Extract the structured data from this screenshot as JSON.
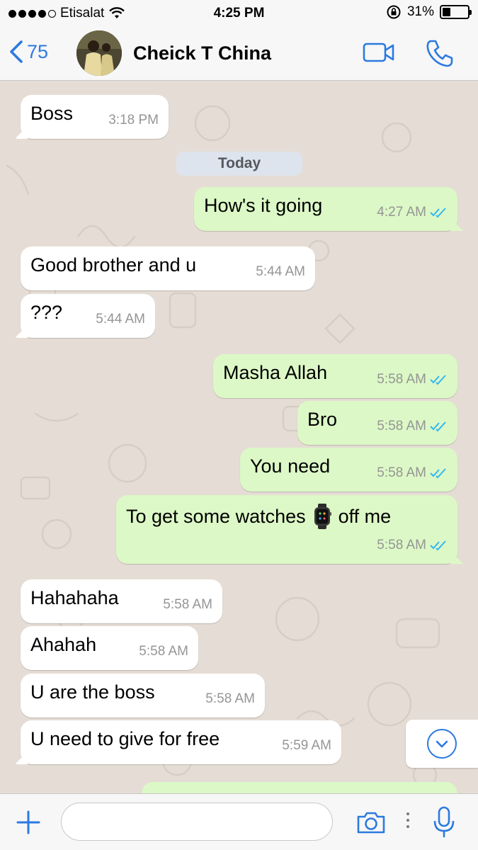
{
  "status_bar": {
    "carrier": "Etisalat",
    "time": "4:25 PM",
    "battery": "31%",
    "battery_level": 0.31
  },
  "header": {
    "back_count": "75",
    "contact_name": "Cheick T China"
  },
  "date_separator": "Today",
  "messages": [
    {
      "text": "Boss",
      "time": "3:18 PM",
      "direction": "in"
    },
    {
      "text": "How's it going",
      "time": "4:27 AM",
      "direction": "out"
    },
    {
      "text": "Good brother and u",
      "time": "5:44 AM",
      "direction": "in"
    },
    {
      "text": "???",
      "time": "5:44 AM",
      "direction": "in"
    },
    {
      "text": "Masha Allah",
      "time": "5:58 AM",
      "direction": "out"
    },
    {
      "text": "Bro",
      "time": "5:58 AM",
      "direction": "out"
    },
    {
      "text": "You need",
      "time": "5:58 AM",
      "direction": "out"
    },
    {
      "text": "To get some watches",
      "text_after": "off me",
      "time": "5:58 AM",
      "direction": "out",
      "emoji": "watch-icon"
    },
    {
      "text": "Hahahaha",
      "time": "5:58 AM",
      "direction": "in"
    },
    {
      "text": "Ahahah",
      "time": "5:58 AM",
      "direction": "in"
    },
    {
      "text": "U are the boss",
      "time": "5:58 AM",
      "direction": "in"
    },
    {
      "text": "U need to give for free",
      "time": "5:59 AM",
      "direction": "in"
    }
  ],
  "input": {
    "placeholder": "",
    "value": ""
  },
  "colors": {
    "accent": "#2c7ae0",
    "outgoing_bubble": "#dcf8c6",
    "incoming_bubble": "#ffffff",
    "chat_background": "#e5ddd5",
    "read_ticks": "#34b7f1"
  }
}
